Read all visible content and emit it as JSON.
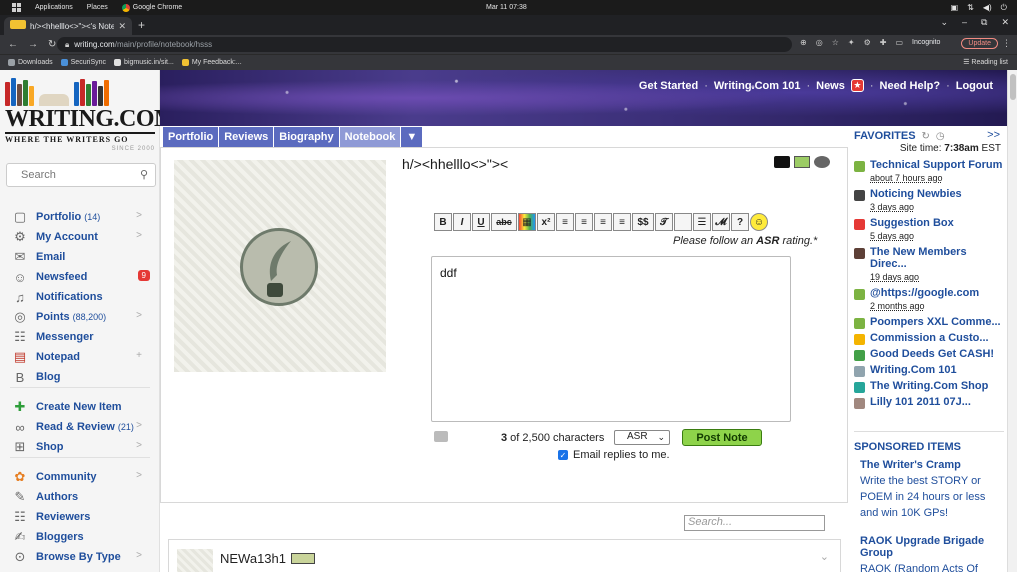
{
  "os": {
    "menu_applications": "Applications",
    "menu_places": "Places",
    "menu_browser": "Google Chrome",
    "clock": "Mar 11  07:38"
  },
  "browser": {
    "tab_title": "h/><hhelllo<>\"><'s Note",
    "url_host": "writing.com",
    "url_path": "/main/profile/notebook/hsss",
    "incognito_label": "Incognito",
    "update_label": "Update",
    "reading_list_label": "Reading list",
    "bookmarks": [
      {
        "label": "Downloads",
        "color": "#9aa0a6"
      },
      {
        "label": "SecuriSync",
        "color": "#4a90d9"
      },
      {
        "label": "bigmusic.in/sit...",
        "color": "#e0e0e0"
      },
      {
        "label": "My Feedback:...",
        "color": "#f1c232"
      }
    ]
  },
  "header": {
    "links": [
      "Get Started",
      "Writing.Com 101",
      "News",
      "Need Help?",
      "Logout"
    ],
    "news_badge_icon": "star-icon"
  },
  "logo": {
    "wordmark": "WRITING.COM",
    "tagline": "WHERE THE WRITERS GO",
    "since": "SINCE 2000"
  },
  "sidebar": {
    "search_placeholder": "Search",
    "items": [
      {
        "label": "Portfolio",
        "count": "(14)",
        "icon": "folder-icon",
        "chevron": ">"
      },
      {
        "label": "My Account",
        "count": "",
        "icon": "gear-icon",
        "chevron": ">"
      },
      {
        "label": "Email",
        "count": "",
        "icon": "envelope-icon",
        "chevron": ""
      },
      {
        "label": "Newsfeed",
        "count": "",
        "icon": "people-icon",
        "badge": "9"
      },
      {
        "label": "Notifications",
        "count": "",
        "icon": "bell-icon",
        "chevron": ""
      },
      {
        "label": "Points",
        "count": "(88,200)",
        "icon": "coins-icon",
        "chevron": ">"
      },
      {
        "label": "Messenger",
        "count": "",
        "icon": "chat-icon",
        "chevron": ""
      },
      {
        "label": "Notepad",
        "count": "",
        "icon": "notepad-icon",
        "chevron": "+"
      },
      {
        "label": "Blog",
        "count": "",
        "icon": "blog-icon",
        "chevron": ""
      }
    ],
    "items2": [
      {
        "label": "Create New Item",
        "count": "",
        "icon": "plus-icon",
        "chevron": ""
      },
      {
        "label": "Read & Review",
        "count": "(21)",
        "icon": "glasses-icon",
        "chevron": ">"
      },
      {
        "label": "Shop",
        "count": "",
        "icon": "cart-icon",
        "chevron": ">"
      }
    ],
    "items3": [
      {
        "label": "Community",
        "count": "",
        "icon": "community-icon",
        "chevron": ">"
      },
      {
        "label": "Authors",
        "count": "",
        "icon": "quill-icon",
        "chevron": ""
      },
      {
        "label": "Reviewers",
        "count": "",
        "icon": "review-bubble-icon",
        "chevron": ""
      },
      {
        "label": "Bloggers",
        "count": "",
        "icon": "blogger-icon",
        "chevron": ""
      },
      {
        "label": "Browse By Type",
        "count": "",
        "icon": "compass-icon",
        "chevron": ">"
      }
    ]
  },
  "profile_tabs": [
    "Portfolio",
    "Reviews",
    "Biography",
    "Notebook",
    "▼"
  ],
  "profile": {
    "name": "h/><hhelllo<>\"><"
  },
  "editor": {
    "format_buttons": [
      "B",
      "I",
      "U",
      "abc",
      "▦",
      "x²",
      "≡",
      "≡",
      "≡",
      "≡",
      "$$",
      "𝒯",
      " ",
      "☰",
      "𝓜",
      "?",
      "☺"
    ],
    "asr_prefix": "Please follow an ",
    "asr_bold": "ASR",
    "asr_suffix": " rating.*",
    "note_text": "ddf",
    "char_count": "3",
    "char_count_suffix": " of 2,500 characters",
    "rating_select": "ASR",
    "post_button": "Post Note",
    "email_replies_label": "Email replies to me.",
    "email_replies_checked": true
  },
  "feed": {
    "search_placeholder": "Search...",
    "entry_name": "NEWa13h1"
  },
  "favorites": {
    "title": "FAVORITES",
    "more": ">>",
    "site_time_label": "Site time: ",
    "site_time_value": "7:38am",
    "site_time_zone": " EST",
    "items": [
      {
        "title": "Technical Support Forum",
        "date": "about 7 hours ago",
        "color": "#7cb342"
      },
      {
        "title": "Noticing Newbies",
        "date": "3 days ago",
        "color": "#444444"
      },
      {
        "title": "Suggestion Box",
        "date": "5 days ago",
        "color": "#e53935"
      },
      {
        "title": "The New Members Direc...",
        "date": "19 days ago",
        "color": "#5d4037"
      },
      {
        "title": "@https://google.com",
        "date": "2 months ago",
        "color": "#7cb342"
      },
      {
        "title": "Poompers XXL Comme...",
        "date": "",
        "color": "#7cb342"
      },
      {
        "title": "Commission a Custo...",
        "date": "",
        "color": "#f4b400"
      },
      {
        "title": "Good Deeds Get CASH!",
        "date": "",
        "color": "#43a047"
      },
      {
        "title": "Writing.Com 101",
        "date": "",
        "color": "#90a4ae"
      },
      {
        "title": "The Writing.Com Shop",
        "date": "",
        "color": "#26a69a"
      },
      {
        "title": "Lilly 101 2011 07J...",
        "date": "",
        "color": "#a1887f"
      }
    ]
  },
  "sponsored": {
    "title": "SPONSORED ITEMS",
    "items": [
      {
        "title": "The Writer's Cramp",
        "desc": "Write the best STORY or POEM in 24 hours or less and win 10K GPs!"
      },
      {
        "title": "RAOK Upgrade Brigade Group",
        "desc": "RAOK (Random Acts Of"
      }
    ]
  }
}
